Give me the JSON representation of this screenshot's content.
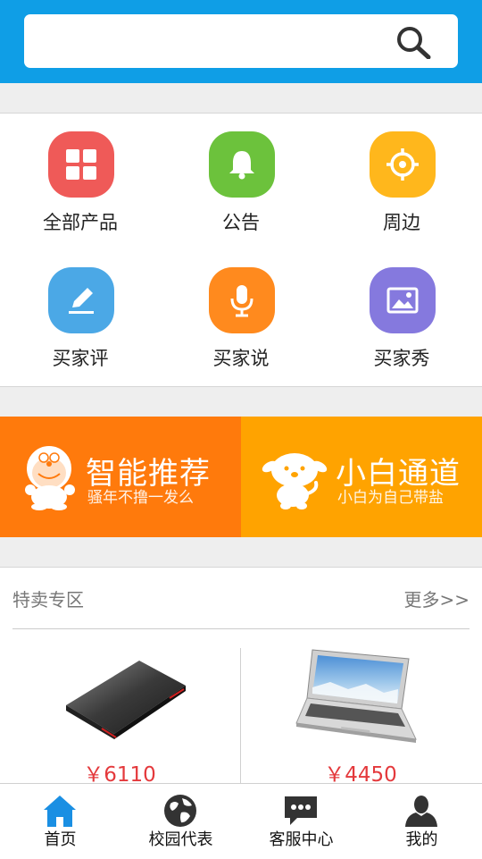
{
  "search": {
    "placeholder": ""
  },
  "grid": {
    "items": [
      {
        "label": "全部产品",
        "icon": "grid-apps-icon",
        "color": "#ef5a58"
      },
      {
        "label": "公告",
        "icon": "bell-icon",
        "color": "#6cc23c"
      },
      {
        "label": "周边",
        "icon": "crosshair-icon",
        "color": "#ffb71c"
      },
      {
        "label": "买家评",
        "icon": "pencil-icon",
        "color": "#4ba8e6"
      },
      {
        "label": "买家说",
        "icon": "microphone-icon",
        "color": "#ff8a1e"
      },
      {
        "label": "买家秀",
        "icon": "image-icon",
        "color": "#8579de"
      }
    ]
  },
  "banners": {
    "left": {
      "title": "智能推荐",
      "subtitle": "骚年不撸一发么",
      "color": "#ff7a0c"
    },
    "right": {
      "title": "小白通道",
      "subtitle": "小白为自己带盐",
      "color": "#ffa300"
    }
  },
  "sale": {
    "title": "特卖专区",
    "more": "更多>>",
    "products": [
      {
        "price": "￥6110"
      },
      {
        "price": "￥4450"
      }
    ]
  },
  "tabbar": {
    "tabs": [
      {
        "label": "首页",
        "icon": "home-icon",
        "active": true
      },
      {
        "label": "校园代表",
        "icon": "globe-icon"
      },
      {
        "label": "客服中心",
        "icon": "chat-icon"
      },
      {
        "label": "我的",
        "icon": "user-icon"
      }
    ]
  },
  "colors": {
    "header": "#0f9ee6",
    "price": "#e4393c",
    "active_tab": "#1a8fe3"
  }
}
